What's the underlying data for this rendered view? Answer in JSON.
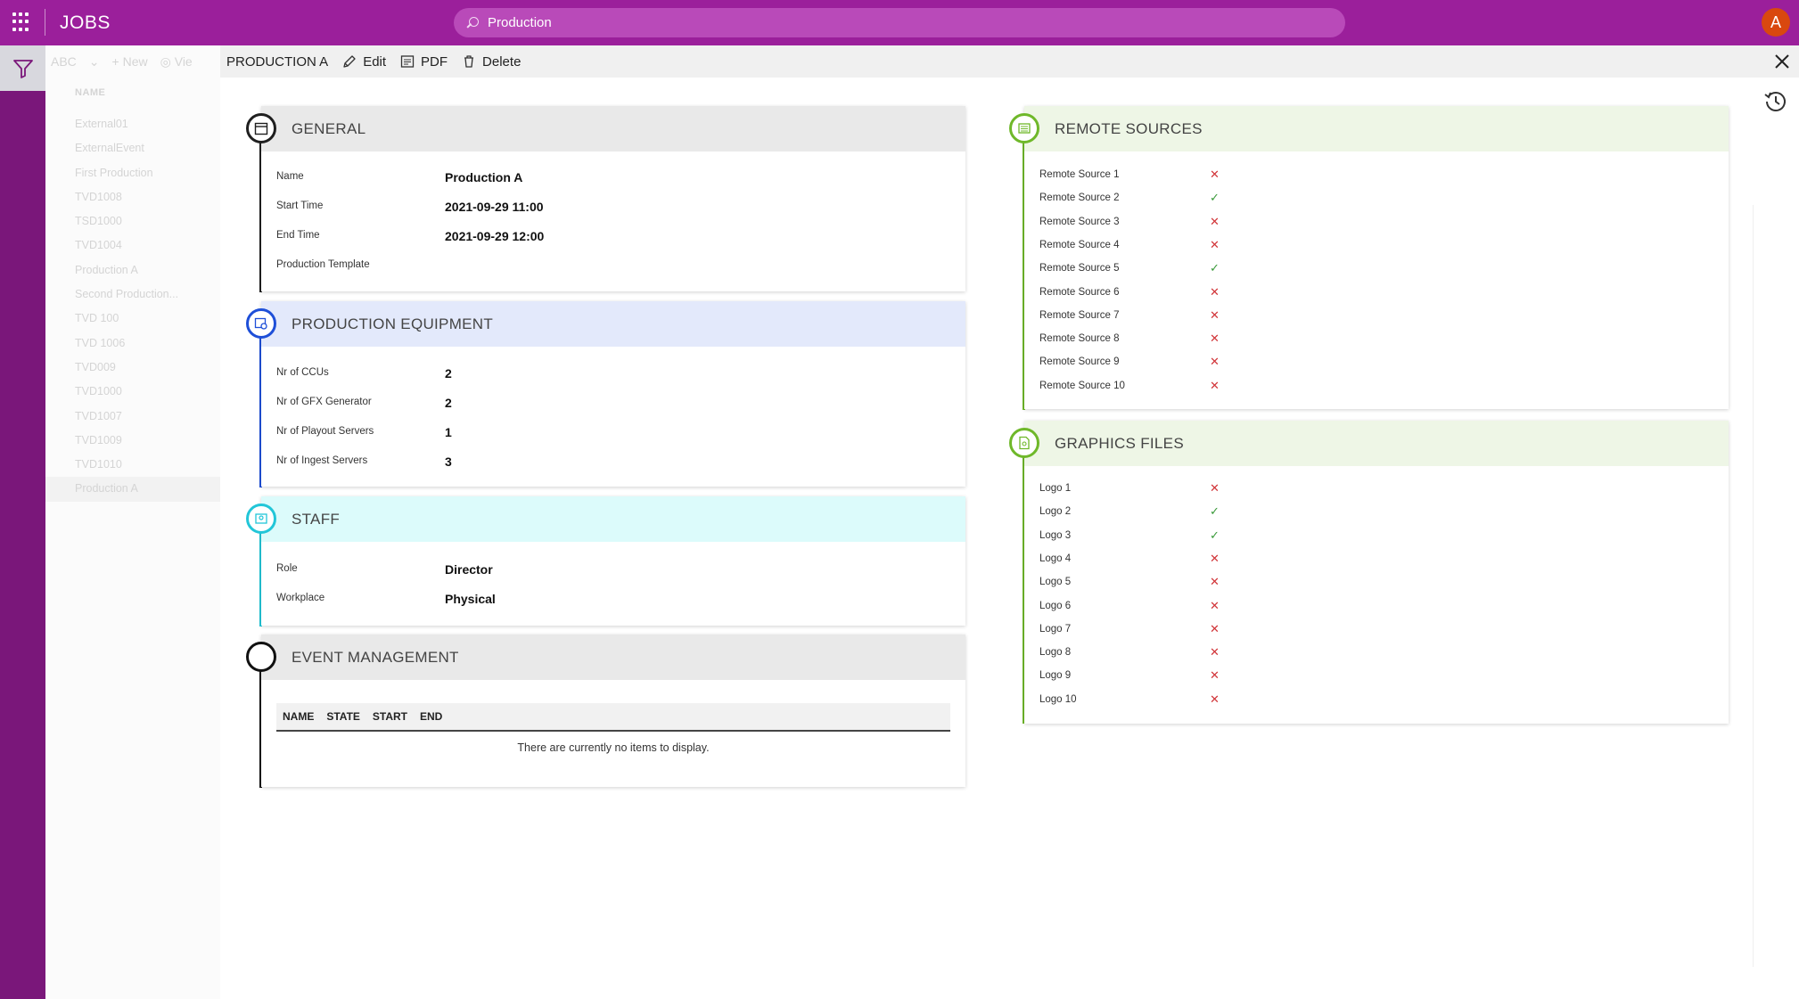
{
  "app": {
    "title": "JOBS",
    "user_initial": "A"
  },
  "search": {
    "value": "Production"
  },
  "colors": {
    "brand": "#9b1f9b",
    "rail": "#7a177a",
    "general": "#1f1f1f",
    "equipment": "#1e4fd8",
    "staff": "#22c6d8",
    "event": "#111111",
    "remote": "#6fb82a",
    "graphics": "#6fb82a",
    "no": "#d13438",
    "yes": "#3a9a3a"
  },
  "listpane": {
    "toolbar": {
      "abc": "ABC",
      "new": "New",
      "view": "Vie"
    },
    "column_header": "NAME",
    "items": [
      "External01",
      "ExternalEvent",
      "First Production",
      "TVD1008",
      "TSD1000",
      "TVD1004",
      "Production A",
      "Second Production...",
      "TVD 100",
      "TVD 1006",
      "TVD009",
      "TVD1000",
      "TVD1007",
      "TVD1009",
      "TVD1010",
      "Production A"
    ]
  },
  "toolbar": {
    "record_title": "PRODUCTION A",
    "edit_label": "Edit",
    "pdf_label": "PDF",
    "delete_label": "Delete"
  },
  "general": {
    "title": "GENERAL",
    "fields": [
      {
        "label": "Name",
        "value": "Production A"
      },
      {
        "label": "Start Time",
        "value": "2021-09-29 11:00"
      },
      {
        "label": "End Time",
        "value": "2021-09-29 12:00"
      },
      {
        "label": "Production Template",
        "value": ""
      }
    ]
  },
  "equipment": {
    "title": "PRODUCTION EQUIPMENT",
    "fields": [
      {
        "label": "Nr of CCUs",
        "value": "2"
      },
      {
        "label": "Nr of GFX Generator",
        "value": "2"
      },
      {
        "label": "Nr of Playout Servers",
        "value": "1"
      },
      {
        "label": "Nr of Ingest Servers",
        "value": "3"
      }
    ]
  },
  "staff": {
    "title": "STAFF",
    "fields": [
      {
        "label": "Role",
        "value": "Director"
      },
      {
        "label": "Workplace",
        "value": "Physical"
      }
    ]
  },
  "event_management": {
    "title": "EVENT MANAGEMENT",
    "columns": [
      "NAME",
      "STATE",
      "START",
      "END"
    ],
    "empty_message": "There are currently no items to display."
  },
  "remote_sources": {
    "title": "REMOTE SOURCES",
    "items": [
      {
        "label": "Remote Source 1",
        "checked": false
      },
      {
        "label": "Remote Source 2",
        "checked": true
      },
      {
        "label": "Remote Source 3",
        "checked": false
      },
      {
        "label": "Remote Source 4",
        "checked": false
      },
      {
        "label": "Remote Source 5",
        "checked": true
      },
      {
        "label": "Remote Source 6",
        "checked": false
      },
      {
        "label": "Remote Source 7",
        "checked": false
      },
      {
        "label": "Remote Source 8",
        "checked": false
      },
      {
        "label": "Remote Source 9",
        "checked": false
      },
      {
        "label": "Remote Source 10",
        "checked": false
      }
    ]
  },
  "graphics_files": {
    "title": "GRAPHICS FILES",
    "items": [
      {
        "label": "Logo 1",
        "checked": false
      },
      {
        "label": "Logo 2",
        "checked": true
      },
      {
        "label": "Logo 3",
        "checked": true
      },
      {
        "label": "Logo 4",
        "checked": false
      },
      {
        "label": "Logo 5",
        "checked": false
      },
      {
        "label": "Logo 6",
        "checked": false
      },
      {
        "label": "Logo 7",
        "checked": false
      },
      {
        "label": "Logo 8",
        "checked": false
      },
      {
        "label": "Logo 9",
        "checked": false
      },
      {
        "label": "Logo 10",
        "checked": false
      }
    ]
  }
}
